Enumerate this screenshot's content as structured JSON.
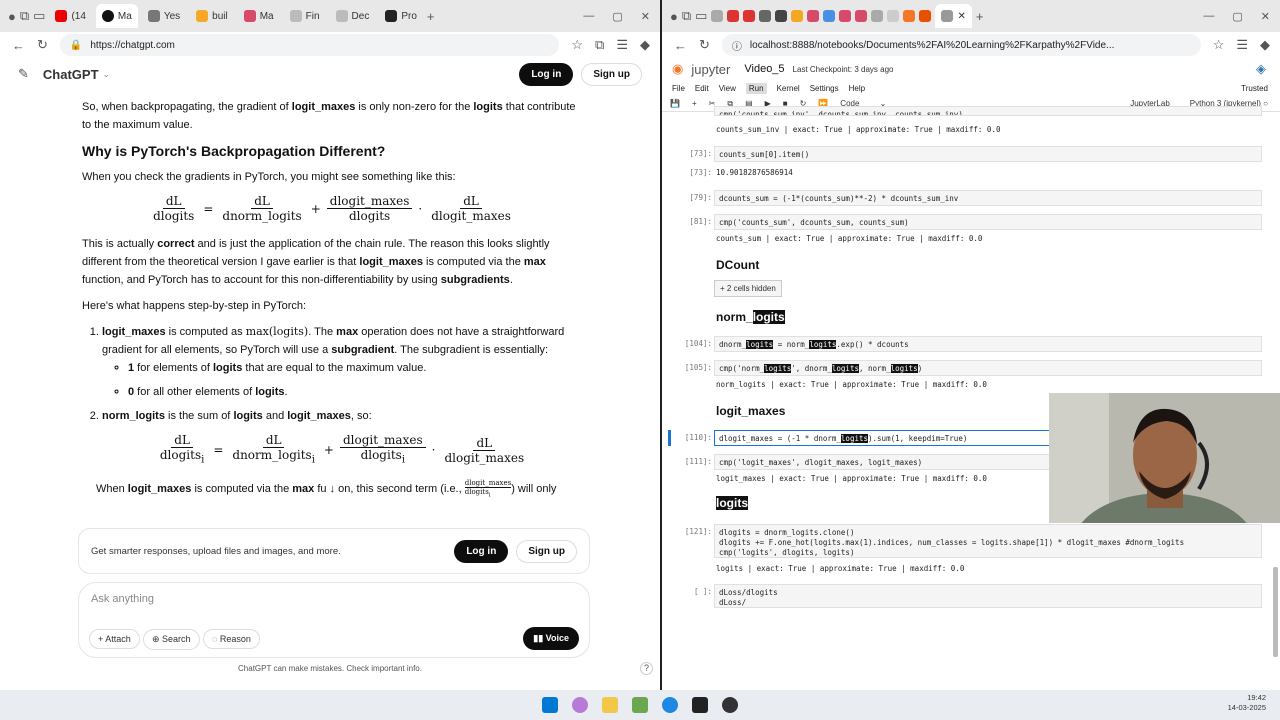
{
  "left_browser": {
    "tabs": [
      "(14",
      "Ma",
      "Yes",
      "buil",
      "Ma",
      "Fin",
      "Dec",
      "Pro"
    ],
    "url": "https://chatgpt.com",
    "app_title": "ChatGPT",
    "login": "Log in",
    "signup": "Sign up",
    "content": {
      "p1_a": "So, when backpropagating, the gradient of ",
      "p1_b": "logit_maxes",
      "p1_c": " is only non-zero for the ",
      "p1_d": "logits",
      "p1_e": " that contribute to the maximum value.",
      "heading": "Why is PyTorch's Backpropagation Different?",
      "p2": "When you check the gradients in PyTorch, you might see something like this:",
      "eq1": {
        "lhs_n": "dL",
        "lhs_d": "dlogits",
        "t1_n": "dL",
        "t1_d": "dnorm_logits",
        "t2_n": "dlogit_maxes",
        "t2_d": "dlogits",
        "t3_n": "dL",
        "t3_d": "dlogit_maxes"
      },
      "p3_a": "This is actually ",
      "p3_b": "correct",
      "p3_c": " and is just the application of the chain rule. The reason this looks slightly different from the theoretical version I gave earlier is that ",
      "p3_d": "logit_maxes",
      "p3_e": " is computed via the ",
      "p3_f": "max",
      "p3_g": " function, and PyTorch has to account for this non-differentiability by using ",
      "p3_h": "subgradients",
      "p3_i": ".",
      "p4": "Here's what happens step-by-step in PyTorch:",
      "li1_a": "logit_maxes",
      "li1_b": " is computed as ",
      "li1_c": "max(logits)",
      "li1_d": ". The ",
      "li1_e": "max",
      "li1_f": " operation does not have a straightforward gradient for all elements, so PyTorch will use a ",
      "li1_g": "subgradient",
      "li1_h": ". The subgradient is essentially:",
      "b1_a": "1",
      "b1_b": " for elements of ",
      "b1_c": "logits",
      "b1_d": " that are equal to the maximum value.",
      "b2_a": "0",
      "b2_b": " for all other elements of ",
      "b2_c": "logits",
      "b2_d": ".",
      "li2_a": "norm_logits",
      "li2_b": " is the sum of ",
      "li2_c": "logits",
      "li2_d": " and ",
      "li2_e": "logit_maxes",
      "li2_f": ", so:",
      "eq2": {
        "lhs_n": "dL",
        "lhs_d": "dlogits",
        "t1_n": "dL",
        "t1_d": "dnorm_logits",
        "t2_n": "dlogit_maxes",
        "t2_d": "dlogits",
        "t3_n": "dL",
        "t3_d": "dlogit_maxes",
        "sub": "i"
      },
      "p5_a": "When ",
      "p5_b": "logit_maxes",
      "p5_c": " is computed via the ",
      "p5_d": "max",
      "p5_e": " fu",
      "p5_f": "on, this second term (i.e., ",
      "p5_g": ") will only"
    },
    "banner_text": "Get smarter responses, upload files and images, and more.",
    "input_placeholder": "Ask anything",
    "attach": "Attach",
    "search": "Search",
    "reason": "Reason",
    "voice": "Voice",
    "disclaimer": "ChatGPT can make mistakes. Check important info.",
    "help": "?"
  },
  "right_browser": {
    "url": "localhost:8888/notebooks/Documents%2FAI%20Learning%2FKarpathy%2FVide...",
    "jupyter": "jupyter",
    "notebook": "Video_5",
    "checkpoint": "Last Checkpoint: 3 days ago",
    "menu": [
      "File",
      "Edit",
      "View",
      "Run",
      "Kernel",
      "Settings",
      "Help"
    ],
    "trusted": "Trusted",
    "cell_type": "Code",
    "jupyterlab": "JupyterLab",
    "kernel": "Python 3 (ipykernel)",
    "cells": {
      "c0_code": "cmp('counts_sum_inv', dcounts_sum_inv, counts_sum_inv)",
      "c0_out": "counts_sum_inv  | exact: True  | approximate: True  | maxdiff: 0.0",
      "c73_p": "[73]:",
      "c73_code": "counts_sum[0].item()",
      "c73o_p": "[73]:",
      "c73_out": "10.90182876586914",
      "c79_p": "[79]:",
      "c79_code": "dcounts_sum = (-1*(counts_sum)**-2) * dcounts_sum_inv",
      "c81_p": "[81]:",
      "c81_code": "cmp('counts_sum', dcounts_sum, counts_sum)",
      "c81_out": "counts_sum      | exact: True  | approximate: True  | maxdiff: 0.0",
      "h_dcount": "DCount",
      "hidden": "+ 2 cells hidden",
      "h_norm_a": "norm_",
      "h_norm_b": "logits",
      "c104_p": "[104]:",
      "c104_a": "dnorm_",
      "c104_b": "logits",
      "c104_c": " = norm_",
      "c104_d": "logits",
      "c104_e": ".exp() * dcounts",
      "c105_p": "[105]:",
      "c105_a": "cmp('norm_",
      "c105_b": "logits",
      "c105_c": "', dnorm_",
      "c105_d": "logits",
      "c105_e": ", norm_",
      "c105_f": "logits",
      "c105_g": ")",
      "c105_out": "norm_logits     | exact: True  | approximate: True  | maxdiff: 0.0",
      "h_lm": "logit_maxes",
      "c110_p": "[110]:",
      "c110_a": "dlogit_maxes = (-1 * dnorm_",
      "c110_b": "logits",
      "c110_c": ").sum(1, keepdim=True)",
      "c111_p": "[111]:",
      "c111_code": "cmp('logit_maxes', dlogit_maxes, logit_maxes)",
      "c111_out": "logit_maxes     | exact: True  | approximate: True  | maxdiff: 0.0",
      "h_logits": "logits",
      "c121_p": "[121]:",
      "c121_l1": "dlogits = dnorm_logits.clone()",
      "c121_l2": "dlogits += F.one_hot(logits.max(1).indices, num_classes = logits.shape[1]) * dlogit_maxes #dnorm_logits",
      "c121_l3": "cmp('logits', dlogits, logits)",
      "c121_out": "logits          | exact: True  | approximate: True  | maxdiff: 0.0",
      "c_empty_p": "[ ]:",
      "c_empty_l1": "dLoss/dlogits",
      "c_empty_l2": "dLoss/"
    }
  },
  "taskbar": {
    "time": "19:42",
    "date": "14-03-2025"
  }
}
